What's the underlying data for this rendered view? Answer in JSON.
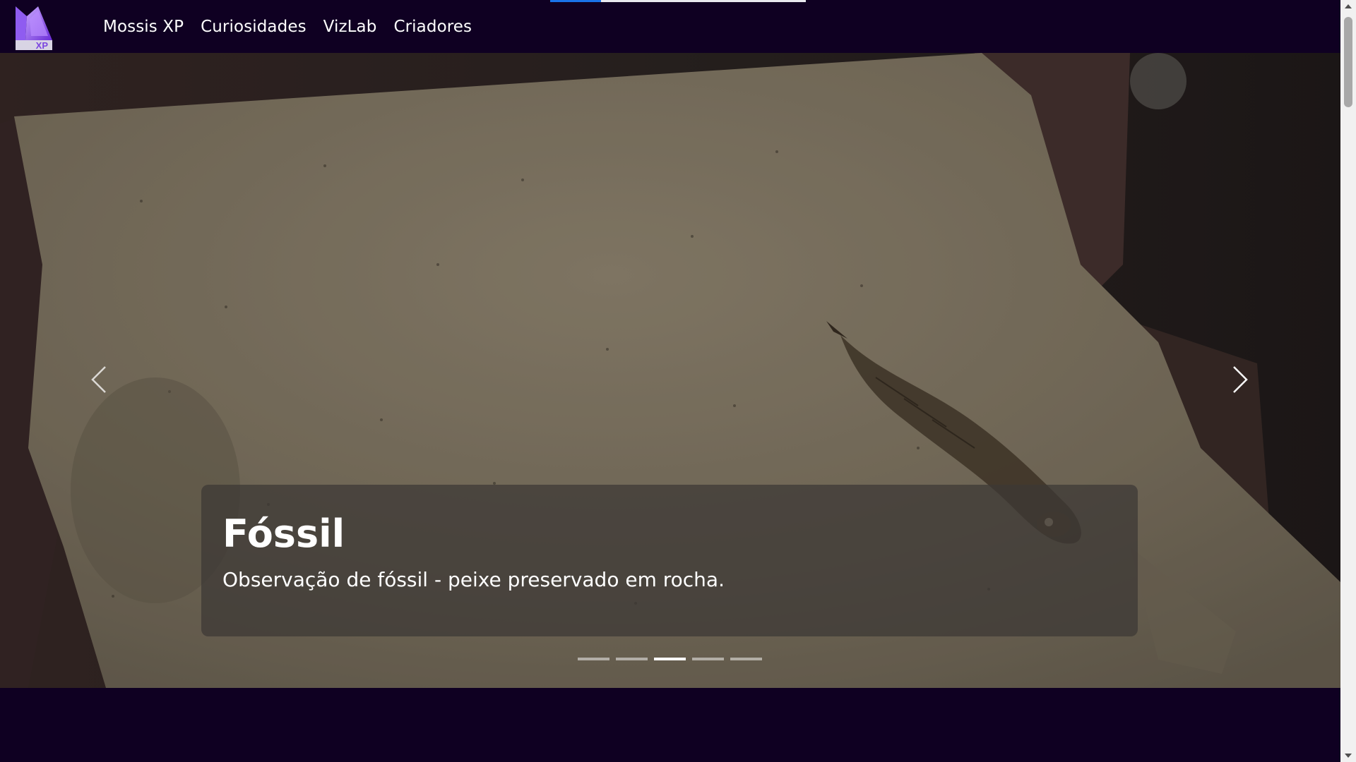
{
  "brand": {
    "logo_text": "XP"
  },
  "nav": {
    "items": [
      {
        "label": "Mossis XP"
      },
      {
        "label": "Curiosidades"
      },
      {
        "label": "VizLab"
      },
      {
        "label": "Criadores"
      }
    ]
  },
  "loading_bar": {
    "progress": 0.2
  },
  "carousel": {
    "active_index": 2,
    "slide_count": 5,
    "current": {
      "title": "Fóssil",
      "description": "Observação de fóssil - peixe preservado em rocha."
    },
    "prev_icon": "chevron-left-icon",
    "next_icon": "chevron-right-icon"
  },
  "colors": {
    "navbar_bg": "#0f0022",
    "page_bg": "#0f0022",
    "loading_accent": "#1a73e8"
  }
}
